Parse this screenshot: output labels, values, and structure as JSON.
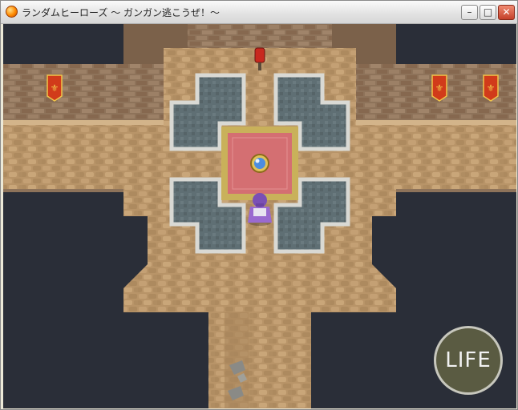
{
  "window": {
    "title": "ランダムヒーローズ ～ ガンガン逃こうぜ！～",
    "app_icon": "orange-orb-icon",
    "controls": {
      "minimize_glyph": "–",
      "maximize_glyph": "□",
      "close_glyph": "✕"
    }
  },
  "hud": {
    "life_label": "LIFE"
  },
  "scene": {
    "floor_color": "#b89468",
    "wall_color": "#8e735a",
    "void_color": "#2a2e38",
    "carpet_color": "#d46f72",
    "carpet_border_color": "#c9b15a",
    "banner_color": "#d13b1a",
    "pool_color": "#5f6f74"
  }
}
